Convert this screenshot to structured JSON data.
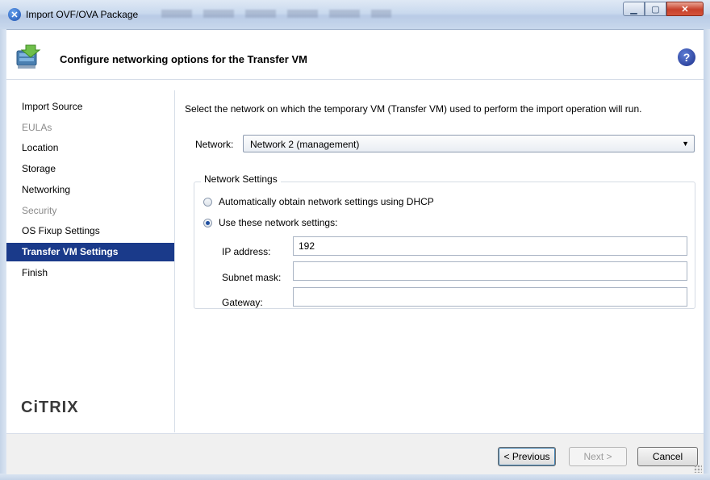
{
  "window": {
    "title": "Import OVF/OVA Package",
    "min_icon": "minimize-icon",
    "max_icon": "maximize-icon",
    "close_icon": "close-icon"
  },
  "header": {
    "title": "Configure networking options for the Transfer VM",
    "icon": "import-package-icon",
    "help_icon": "help-icon",
    "help_glyph": "?"
  },
  "sidebar": {
    "steps": [
      {
        "label": "Import Source",
        "state": "normal"
      },
      {
        "label": "EULAs",
        "state": "disabled"
      },
      {
        "label": "Location",
        "state": "normal"
      },
      {
        "label": "Storage",
        "state": "normal"
      },
      {
        "label": "Networking",
        "state": "normal"
      },
      {
        "label": "Security",
        "state": "disabled"
      },
      {
        "label": "OS Fixup Settings",
        "state": "normal"
      },
      {
        "label": "Transfer VM Settings",
        "state": "active"
      },
      {
        "label": "Finish",
        "state": "normal"
      }
    ],
    "logo_text": "CiTRIX"
  },
  "main": {
    "instruction": "Select the network on which the temporary VM (Transfer VM) used to perform the import operation will run.",
    "network_label": "Network:",
    "network_value": "Network 2 (management)",
    "group_title": "Network Settings",
    "radio_dhcp_label": "Automatically obtain network settings using DHCP",
    "radio_dhcp_checked": false,
    "radio_static_label": "Use these network settings:",
    "radio_static_checked": true,
    "ip_label": "IP address:",
    "ip_value": "192",
    "subnet_label": "Subnet mask:",
    "subnet_value": "",
    "gateway_label": "Gateway:",
    "gateway_value": ""
  },
  "footer": {
    "previous_label": "< Previous",
    "next_label": "Next >",
    "cancel_label": "Cancel"
  },
  "colors": {
    "active_step_bg": "#1a3a8a",
    "disabled_text": "#8a8a8a"
  }
}
